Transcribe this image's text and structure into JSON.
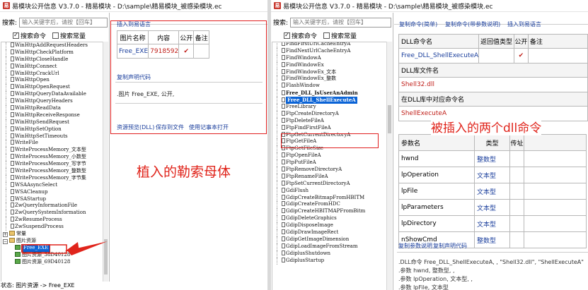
{
  "left_window": {
    "title": "易模块公开信息 V3.7.0 - 精易模块 - D:\\sample\\精易模块_被感染模块.ec",
    "app_icon": "易",
    "search_label": "搜索:",
    "search_placeholder": "输入关键字后，请按【回车】",
    "checkboxes": [
      {
        "label": "搜索命令",
        "checked": true
      },
      {
        "label": "搜索常量",
        "checked": false
      }
    ],
    "tree_items": [
      "WinHttpAddRequestHeaders",
      "WinHttpCheckPlatform",
      "WinHttpCloseHandle",
      "WinHttpConnect",
      "WinHttpCrackUrl",
      "WinHttpOpen",
      "WinHttpOpenRequest",
      "WinHttpQueryDataAvailable",
      "WinHttpQueryHeaders",
      "WinHttpReadData",
      "WinHttpReceiveResponse",
      "WinHttpSendRequest",
      "WinHttpSetOption",
      "WinHttpSetTimeouts",
      "WriteFile",
      "WriteProcessMemory_文本型",
      "WriteProcessMemory_小数型",
      "WriteProcessMemory_写字节",
      "WriteProcessMemory_整数型",
      "WriteProcessMemory_字节集",
      "WSAAsyncSelect",
      "WSACleanup",
      "WSAStartup",
      "ZwQueryInformationFile",
      "ZwQuerySystemInformation",
      "ZwResumeProcess",
      "ZwSuspendProcess"
    ],
    "tree_group_constants": "常量",
    "tree_group_images": "图片资源",
    "tree_image_items": [
      "Free_EXE",
      "图片资源_38D40128",
      "图片资源_69D40128"
    ],
    "status": "状态: 图片资源 -> Free_EXE",
    "right": {
      "link_insert": "插入到易语言",
      "table_headers": [
        "图片名称",
        "内容",
        "公开",
        "备注"
      ],
      "table_row": {
        "name": "Free_EXE",
        "content": "7918592",
        "public": "✔",
        "note": ""
      },
      "link_copy_decl": "复制声明代码",
      "decl_text": ".图片 Free_EXE, 公开,",
      "links_bottom": [
        "资源预览(DLL)",
        "保存到文件",
        "使用记事本打开"
      ],
      "annotation": "植入的勒索母体"
    }
  },
  "right_window": {
    "title": "易模块公开信息 V3.7.0 - 精易模块 - D:\\sample\\精易模块_被感染模块.ec",
    "app_icon": "易",
    "search_label": "搜索:",
    "search_placeholder": "输入关键字后，请按【回车】",
    "checkboxes": [
      {
        "label": "搜索命令",
        "checked": true
      },
      {
        "label": "搜索常量",
        "checked": false
      }
    ],
    "tree_items": [
      "FindFirstUrlCacheEntryA",
      "FindNextUrlCacheEntryA",
      "FindWindowA",
      "FindWindowEx",
      "FindWindowEx_文本",
      "FindWindowEx_整数",
      "FlashWindow",
      "Free_DLL_IsUserAnAdmin",
      "Free_DLL_ShellExecuteA",
      "FreeLibrary",
      "FtpCreateDirectoryA",
      "FtpDeleteFileA",
      "FtpFindFirstFileA",
      "FtpGetCurrentDirectoryA",
      "FtpGetFileA",
      "FtpGetFileSize",
      "FtpOpenFileA",
      "FtpPutFileA",
      "FtpRemoveDirectoryA",
      "FtpRenameFileA",
      "FtpSetCurrentDirectoryA",
      "GdiFlush",
      "GdipCreateBitmapFromHBITM",
      "GdipCreateFromHDC",
      "GdipCreateHBITMAPFromBitm",
      "GdipDeleteGraphics",
      "GdipDisposeImage",
      "GdipDrawImageRect",
      "GdipGetImageDimension",
      "GdipLoadImageFromStream",
      "GdiplusShutdown",
      "GdiplusStartup"
    ],
    "right": {
      "links_top": [
        "复制命令(简单)",
        "复制命令(带参数说明)",
        "插入到易语言"
      ],
      "table_headers": [
        "DLL命令名",
        "返回值类型",
        "公开",
        "备注"
      ],
      "cmd_row": {
        "name": "Free_DLL_ShellExecuteA",
        "return_type": "",
        "public": "✔",
        "note": ""
      },
      "lib_header": "DLL库文件名",
      "lib_value": "Shell32.dll",
      "entry_header": "在DLL库中对应命令名",
      "entry_value": "ShellExecuteA",
      "param_headers": [
        "参数名",
        "类型",
        "传址"
      ],
      "params": [
        {
          "name": "hwnd",
          "type": "整数型"
        },
        {
          "name": "lpOperation",
          "type": "文本型"
        },
        {
          "name": "lpFile",
          "type": "文本型"
        },
        {
          "name": "lpParameters",
          "type": "文本型"
        },
        {
          "name": "lpDirectory",
          "type": "文本型"
        },
        {
          "name": "nShowCmd",
          "type": "整数型"
        }
      ],
      "links_bottom": [
        "复制参数说明",
        "复制声明代码"
      ],
      "decl_lines": [
        ".DLL命令 Free_DLL_ShellExecuteA, , \"Shell32.dll\", \"ShellExecuteA\"",
        "  .参数 hwnd, 整数型, ,",
        "  .参数 lpOperation, 文本型, ,",
        "  .参数 lpFile, 文本型"
      ],
      "annotation": "被插入的两个dll命令"
    }
  },
  "colors": {
    "annotation": "#e0241b",
    "link": "#1a3e9c",
    "selection": "#0a63d6"
  }
}
